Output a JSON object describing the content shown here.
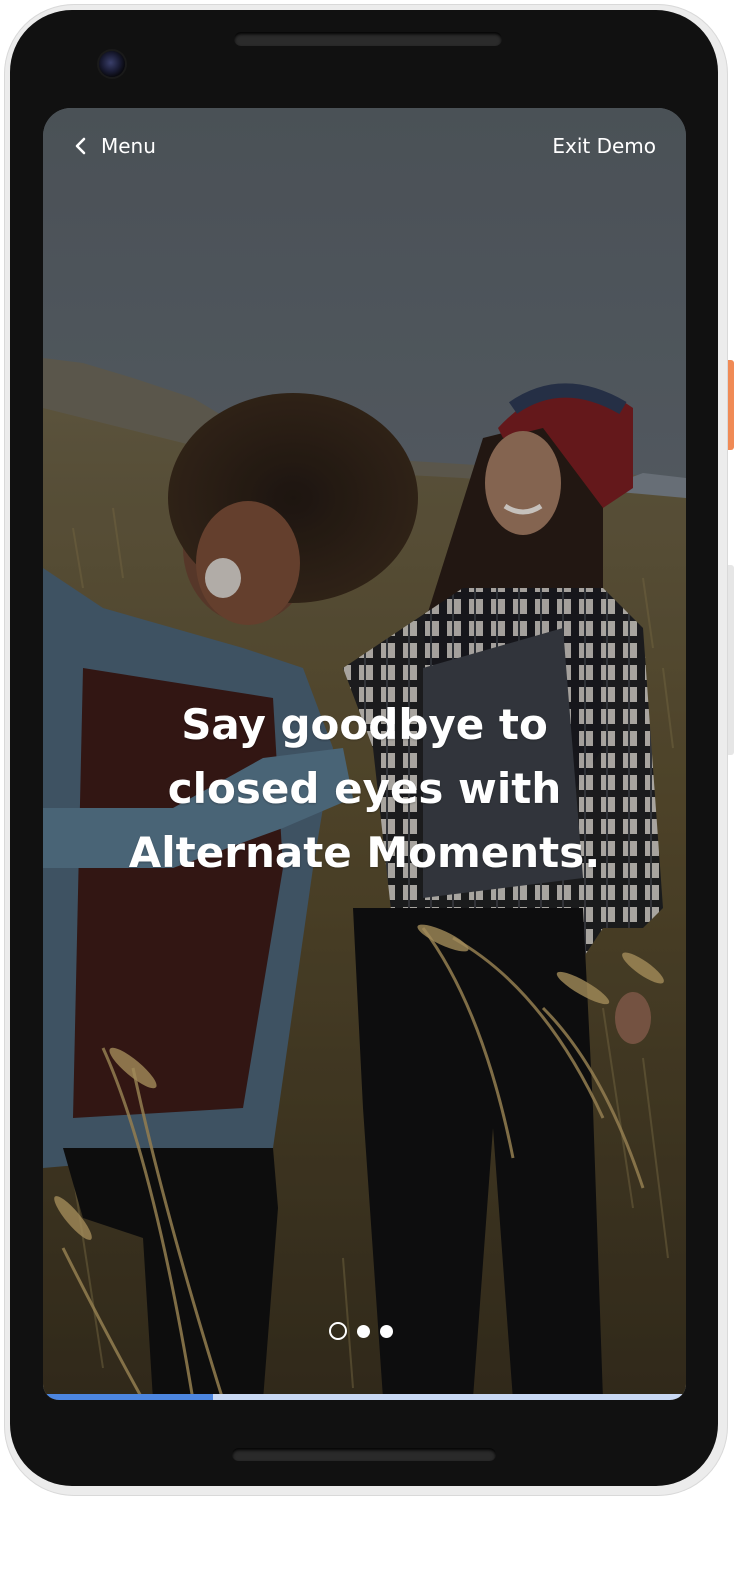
{
  "header": {
    "menu_label": "Menu",
    "exit_label": "Exit Demo"
  },
  "headline": {
    "line1": "Say goodbye to",
    "line2": "closed eyes with",
    "line3": "Alternate Moments."
  },
  "pagination": {
    "current": 1,
    "total": 3
  },
  "progress": {
    "fraction": 0.265
  },
  "colors": {
    "accent_progress": "#4c86e0",
    "progress_track": "#c9d9f4",
    "side_button": "#f08a55"
  },
  "icons": {
    "back": "chevron-left-icon"
  }
}
